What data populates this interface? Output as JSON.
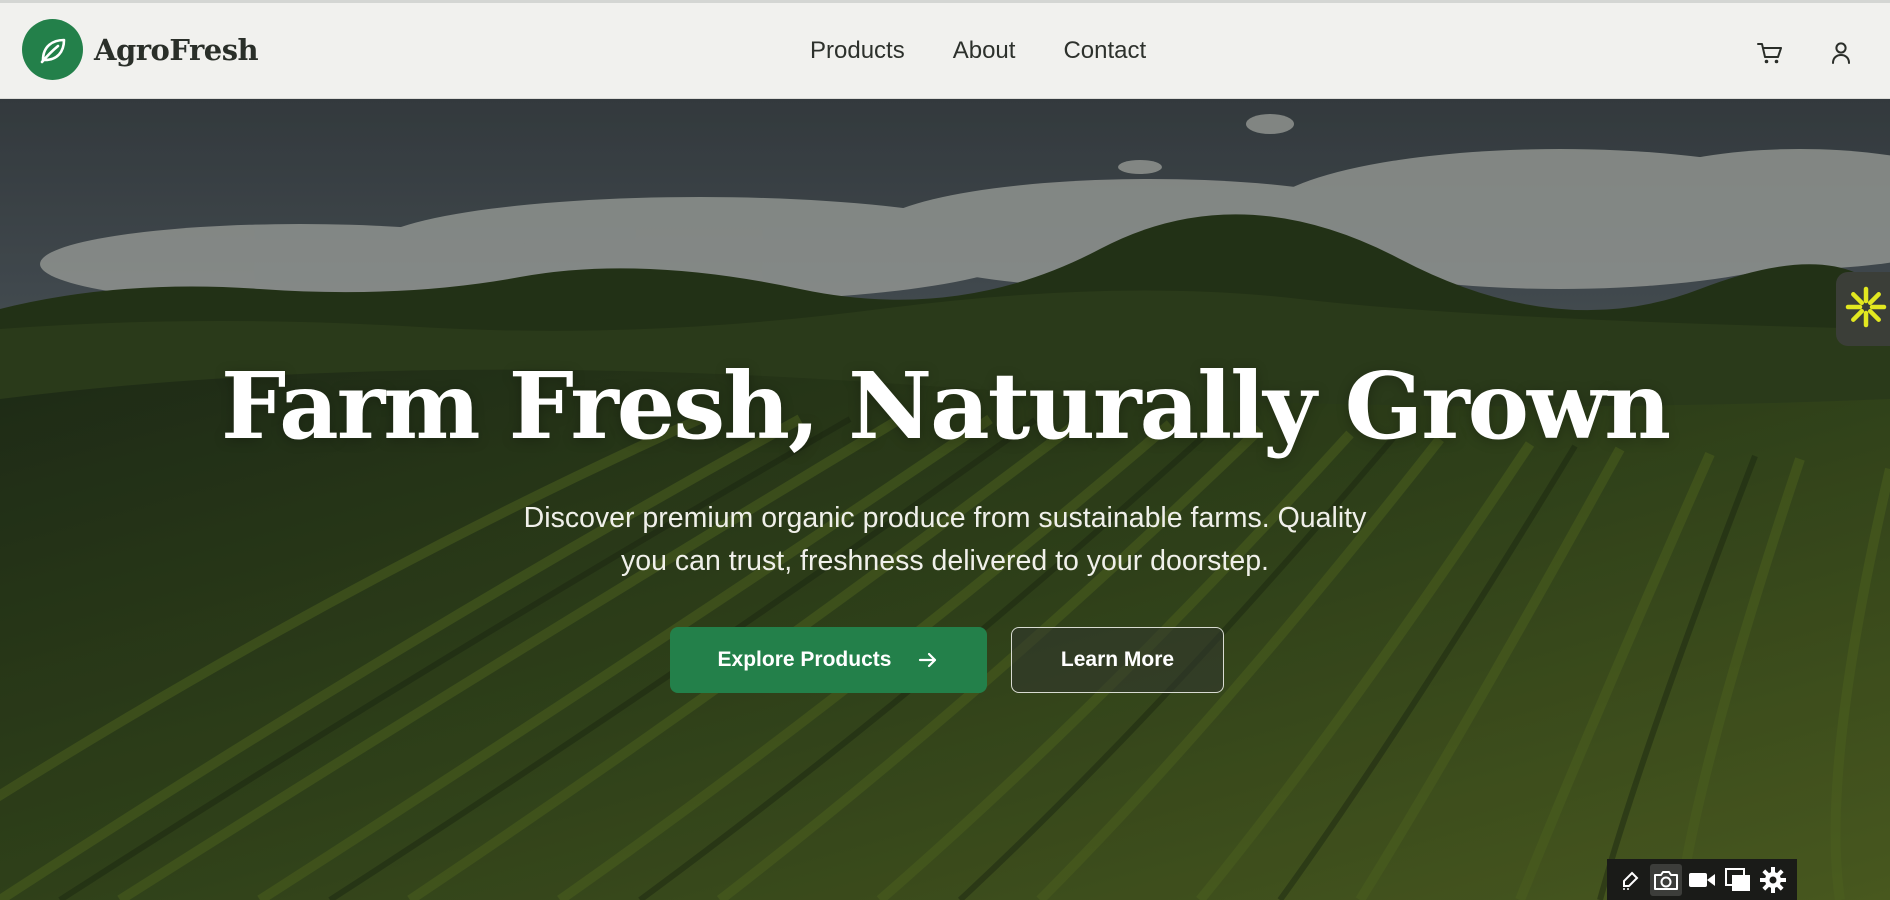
{
  "brand": {
    "name": "AgroFresh",
    "logo_icon": "leaf-icon",
    "color": "#23804a"
  },
  "nav": {
    "links": [
      {
        "label": "Products"
      },
      {
        "label": "About"
      },
      {
        "label": "Contact"
      }
    ],
    "icons": [
      "cart-icon",
      "user-icon"
    ]
  },
  "hero": {
    "title": "Farm Fresh, Naturally Grown",
    "subtitle_line1": "Discover premium organic produce from sustainable farms. Quality",
    "subtitle_line2": "you can trust, freshness delivered to your doorstep.",
    "primary_button": {
      "label": "Explore Products",
      "icon": "arrow-right-icon",
      "color": "#23804a"
    },
    "secondary_button": {
      "label": "Learn More"
    },
    "background": "farm-fields-photo"
  },
  "widgets": {
    "side_tab_icon": "sparkle-icon",
    "side_tab_color": "#e2e820",
    "toolbar_icons": [
      "edit-icon",
      "camera-icon",
      "video-icon",
      "copy-icon",
      "gear-icon"
    ]
  }
}
